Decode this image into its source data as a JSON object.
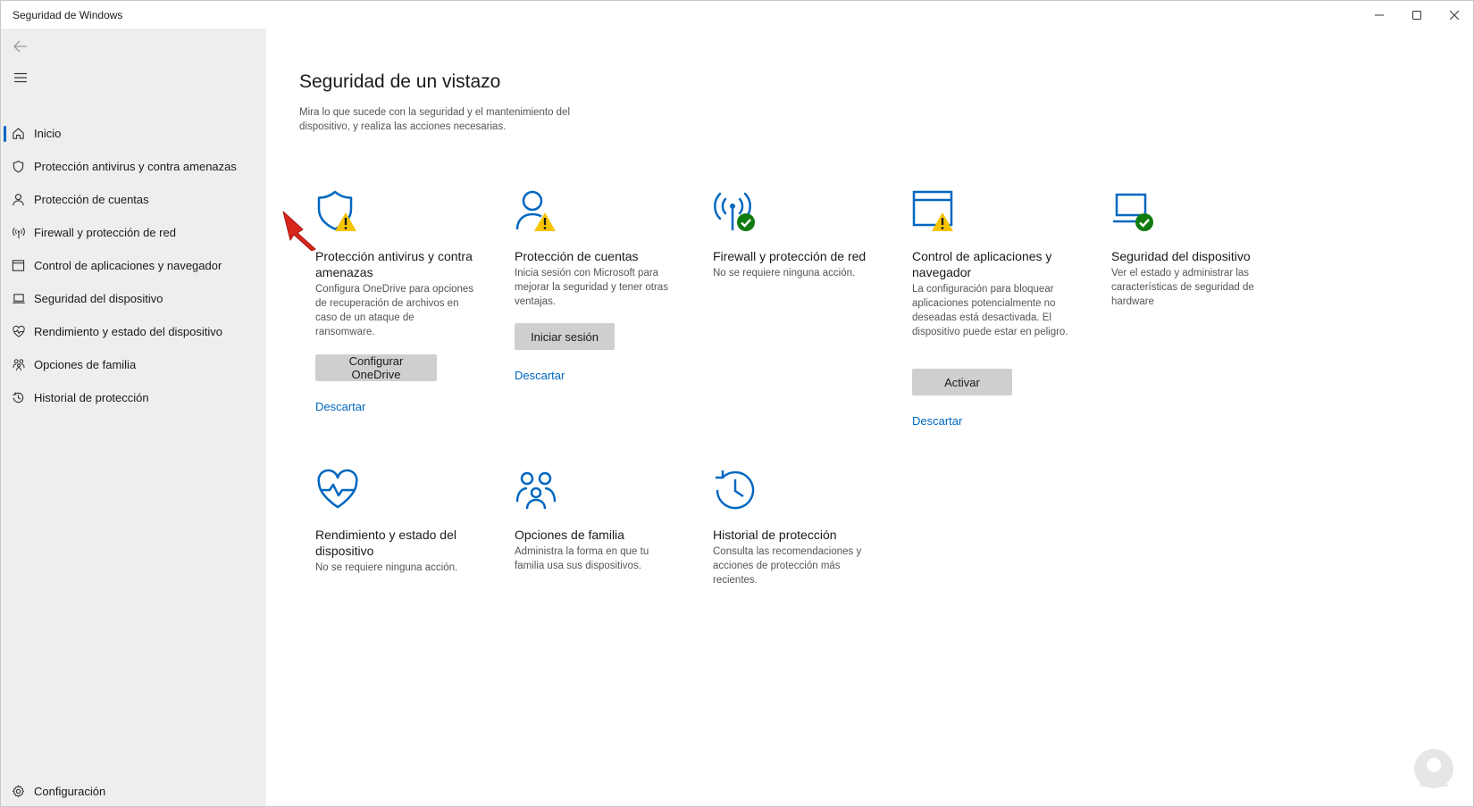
{
  "window": {
    "title": "Seguridad de Windows"
  },
  "sidebar": {
    "items": [
      {
        "label": "Inicio",
        "icon": "home-icon"
      },
      {
        "label": "Protección antivirus y contra amenazas",
        "icon": "shield-icon"
      },
      {
        "label": "Protección de cuentas",
        "icon": "person-icon"
      },
      {
        "label": "Firewall y protección de red",
        "icon": "antenna-icon"
      },
      {
        "label": "Control de aplicaciones y navegador",
        "icon": "app-window-icon"
      },
      {
        "label": "Seguridad del dispositivo",
        "icon": "laptop-icon"
      },
      {
        "label": "Rendimiento y estado del dispositivo",
        "icon": "heart-pulse-icon"
      },
      {
        "label": "Opciones de familia",
        "icon": "family-icon"
      },
      {
        "label": "Historial de protección",
        "icon": "history-icon"
      }
    ],
    "settings_label": "Configuración"
  },
  "main": {
    "title": "Seguridad de un vistazo",
    "description": "Mira lo que sucede con la seguridad y el mantenimiento del dispositivo, y realiza las acciones necesarias.",
    "tiles": [
      {
        "title": "Protección antivirus y contra amenazas",
        "desc": "Configura OneDrive para opciones de recuperación de archivos en caso de un ataque de ransomware.",
        "button": "Configurar OneDrive",
        "link": "Descartar",
        "status": "warning"
      },
      {
        "title": "Protección de cuentas",
        "desc": "Inicia sesión con Microsoft para mejorar la seguridad y tener otras ventajas.",
        "button": "Iniciar sesión",
        "link": "Descartar",
        "status": "warning"
      },
      {
        "title": "Firewall y protección de red",
        "desc": "No se requiere ninguna acción.",
        "status": "ok"
      },
      {
        "title": "Control de aplicaciones y navegador",
        "desc": "La configuración para bloquear aplicaciones potencialmente no deseadas está desactivada. El dispositivo puede estar en peligro.",
        "button": "Activar",
        "link": "Descartar",
        "status": "warning"
      },
      {
        "title": "Seguridad del dispositivo",
        "desc": "Ver el estado y administrar las características de seguridad de hardware",
        "status": "ok"
      },
      {
        "title": "Rendimiento y estado del dispositivo",
        "desc": "No se requiere ninguna acción."
      },
      {
        "title": "Opciones de familia",
        "desc": "Administra la forma en que tu familia usa sus dispositivos."
      },
      {
        "title": "Historial de protección",
        "desc": "Consulta las recomendaciones y acciones de protección más recientes."
      }
    ]
  },
  "colors": {
    "accent": "#0067c0",
    "warning": "#f6c400",
    "ok": "#16a34a",
    "sidebar_bg": "#eeeeee",
    "button_bg": "#cfcfcf"
  }
}
